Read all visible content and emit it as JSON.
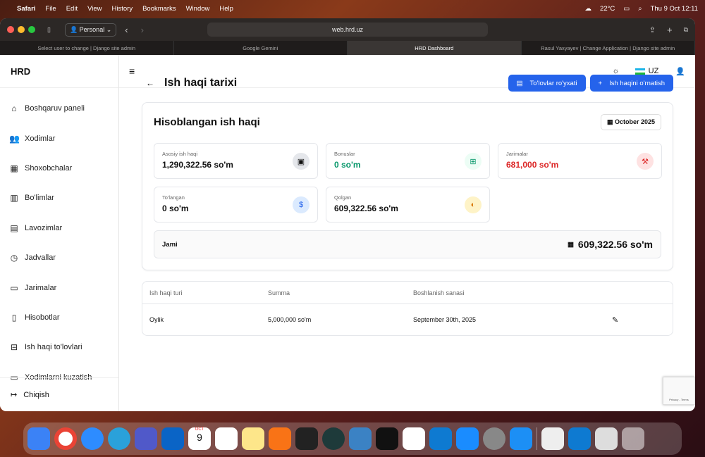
{
  "menubar": {
    "app": "Safari",
    "items": [
      "File",
      "Edit",
      "View",
      "History",
      "Bookmarks",
      "Window",
      "Help"
    ],
    "weather": "22°C",
    "datetime": "Thu 9 Oct  12:11"
  },
  "browser": {
    "profile": "Personal",
    "url": "web.hrd.uz",
    "tabs": [
      "Select user to change | Django site admin",
      "Google Gemini",
      "HRD Dashboard",
      "Rasul Yaxyayev | Change Application | Django site admin"
    ]
  },
  "sidebar": {
    "brand": "HRD",
    "items": [
      {
        "label": "Boshqaruv paneli",
        "icon": "home-icon"
      },
      {
        "label": "Xodimlar",
        "icon": "users-icon"
      },
      {
        "label": "Shoxobchalar",
        "icon": "building-icon"
      },
      {
        "label": "Bo'limlar",
        "icon": "building-small-icon"
      },
      {
        "label": "Lavozimlar",
        "icon": "briefcase-icon"
      },
      {
        "label": "Jadvallar",
        "icon": "clock-icon"
      },
      {
        "label": "Jarimalar",
        "icon": "credit-card-icon"
      },
      {
        "label": "Hisobotlar",
        "icon": "file-icon"
      },
      {
        "label": "Ish haqi to'lovlari",
        "icon": "payment-icon"
      },
      {
        "label": "Xodimlarni kuzatish",
        "icon": "monitor-icon"
      }
    ],
    "logout": "Chiqish"
  },
  "header": {
    "lang": "UZ"
  },
  "page": {
    "title": "Ish haqi tarixi",
    "btn_payments": "To'lovlar ro'yxati",
    "btn_set_salary": "Ish haqini o'rnatish"
  },
  "summary": {
    "title": "Hisoblangan ish haqi",
    "month": "October 2025",
    "stats": [
      {
        "label": "Asosiy ish haqi",
        "value": "1,290,322.56 so'm",
        "color": "#111111"
      },
      {
        "label": "Bonuslar",
        "value": "0 so'm",
        "color": "#059669"
      },
      {
        "label": "Jarimalar",
        "value": "681,000 so'm",
        "color": "#dc2626"
      },
      {
        "label": "To'langan",
        "value": "0 so'm",
        "color": "#111111"
      },
      {
        "label": "Qolgan",
        "value": "609,322.56 so'm",
        "color": "#111111"
      }
    ],
    "total_label": "Jami",
    "total_value": "609,322.56 so'm"
  },
  "table": {
    "headers": [
      "Ish haqi turi",
      "Summa",
      "Boshlanish sanasi"
    ],
    "rows": [
      {
        "type": "Oylik",
        "amount": "5,000,000 so'm",
        "start": "September 30th, 2025"
      }
    ]
  },
  "recaptcha": "Privacy - Terms",
  "dock": {
    "calendar_month": "OCT",
    "calendar_day": "9"
  }
}
